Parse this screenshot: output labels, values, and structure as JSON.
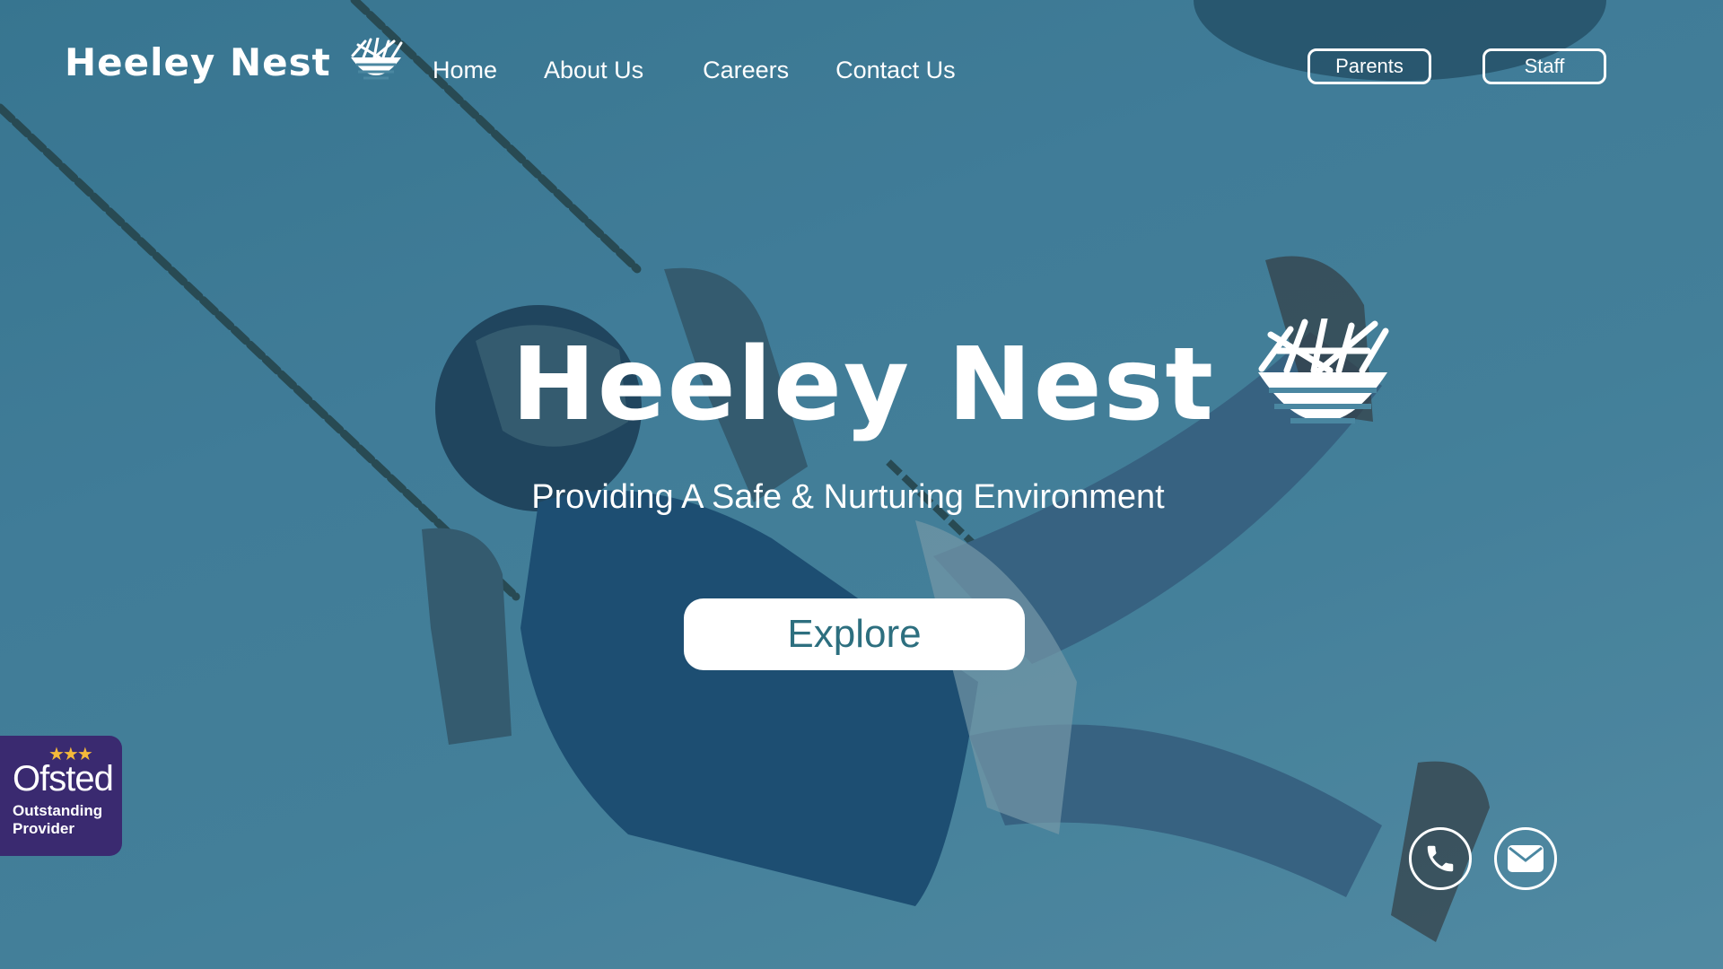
{
  "header": {
    "brand": "Heeley Nest",
    "nav": [
      "Home",
      "About Us",
      "Careers",
      "Contact Us"
    ],
    "parents_label": "Parents",
    "staff_label": "Staff"
  },
  "hero": {
    "title": "Heeley Nest",
    "subtitle": "Providing A Safe & Nurturing Environment",
    "cta_label": "Explore"
  },
  "badge": {
    "name": "Ofsted",
    "rating_line1": "Outstanding",
    "rating_line2": "Provider"
  },
  "contact_icons": [
    "phone-icon",
    "mail-icon"
  ],
  "colors": {
    "overlay_blue": "#4a87a1",
    "cta_text": "#2d6f7f",
    "badge_purple": "#3a2a70",
    "badge_star": "#f4b93a"
  }
}
